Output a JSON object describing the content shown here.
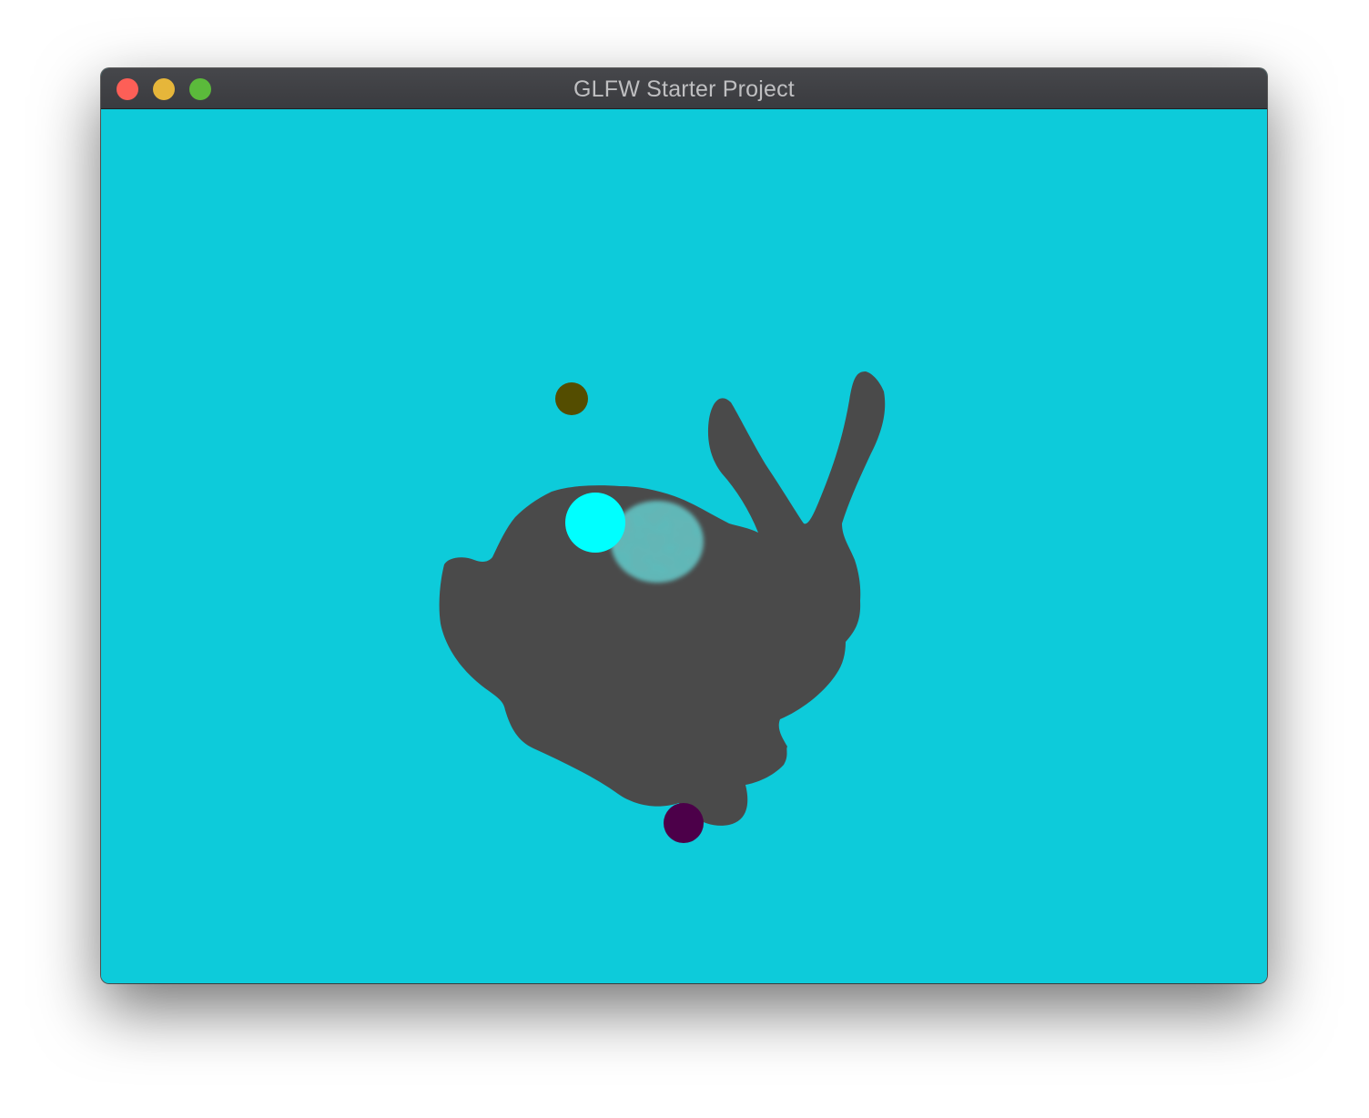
{
  "window": {
    "title": "GLFW Starter Project",
    "controls": {
      "close_color": "#fd5f57",
      "minimize_color": "#e6b63a",
      "maximize_color": "#5bba3b"
    }
  },
  "scene": {
    "background_color": "#0dcbda",
    "model_color": "#4a4a4a",
    "lights": [
      {
        "name": "olive-light",
        "color": "#544d00"
      },
      {
        "name": "cyan-light",
        "color": "#00ffff"
      },
      {
        "name": "purple-light",
        "color": "#4c0049"
      }
    ],
    "reflective_sphere_color": "#5fd4d4"
  }
}
